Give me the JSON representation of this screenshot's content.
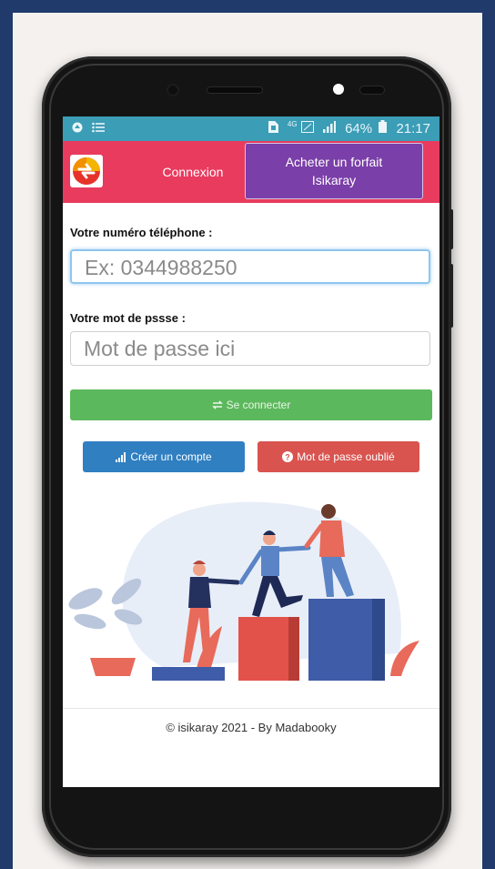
{
  "statusbar": {
    "left_icons": [
      "app-icon",
      "menu-lines-icon"
    ],
    "network": "4G",
    "battery": "64%",
    "time": "21:17"
  },
  "nav": {
    "connexion": "Connexion",
    "acheter_line1": "Acheter un forfait",
    "acheter_line2": "Isikaray"
  },
  "form": {
    "phone_label": "Votre numéro téléphone :",
    "phone_placeholder": "Ex: 0344988250",
    "password_label": "Votre mot de pssse :",
    "password_placeholder": "Mot de passe ici",
    "connect_label": "Se connecter",
    "create_label": "Créer un compte",
    "forgot_label": "Mot de passe oublié"
  },
  "footer": "© isikaray 2021 - By Madabooky",
  "colors": {
    "statusbar": "#3b9db6",
    "nav": "#e83b5e",
    "acheter": "#7a3fa8",
    "connect": "#5cb85c",
    "create": "#2f7fc1",
    "forgot": "#d9534f"
  }
}
